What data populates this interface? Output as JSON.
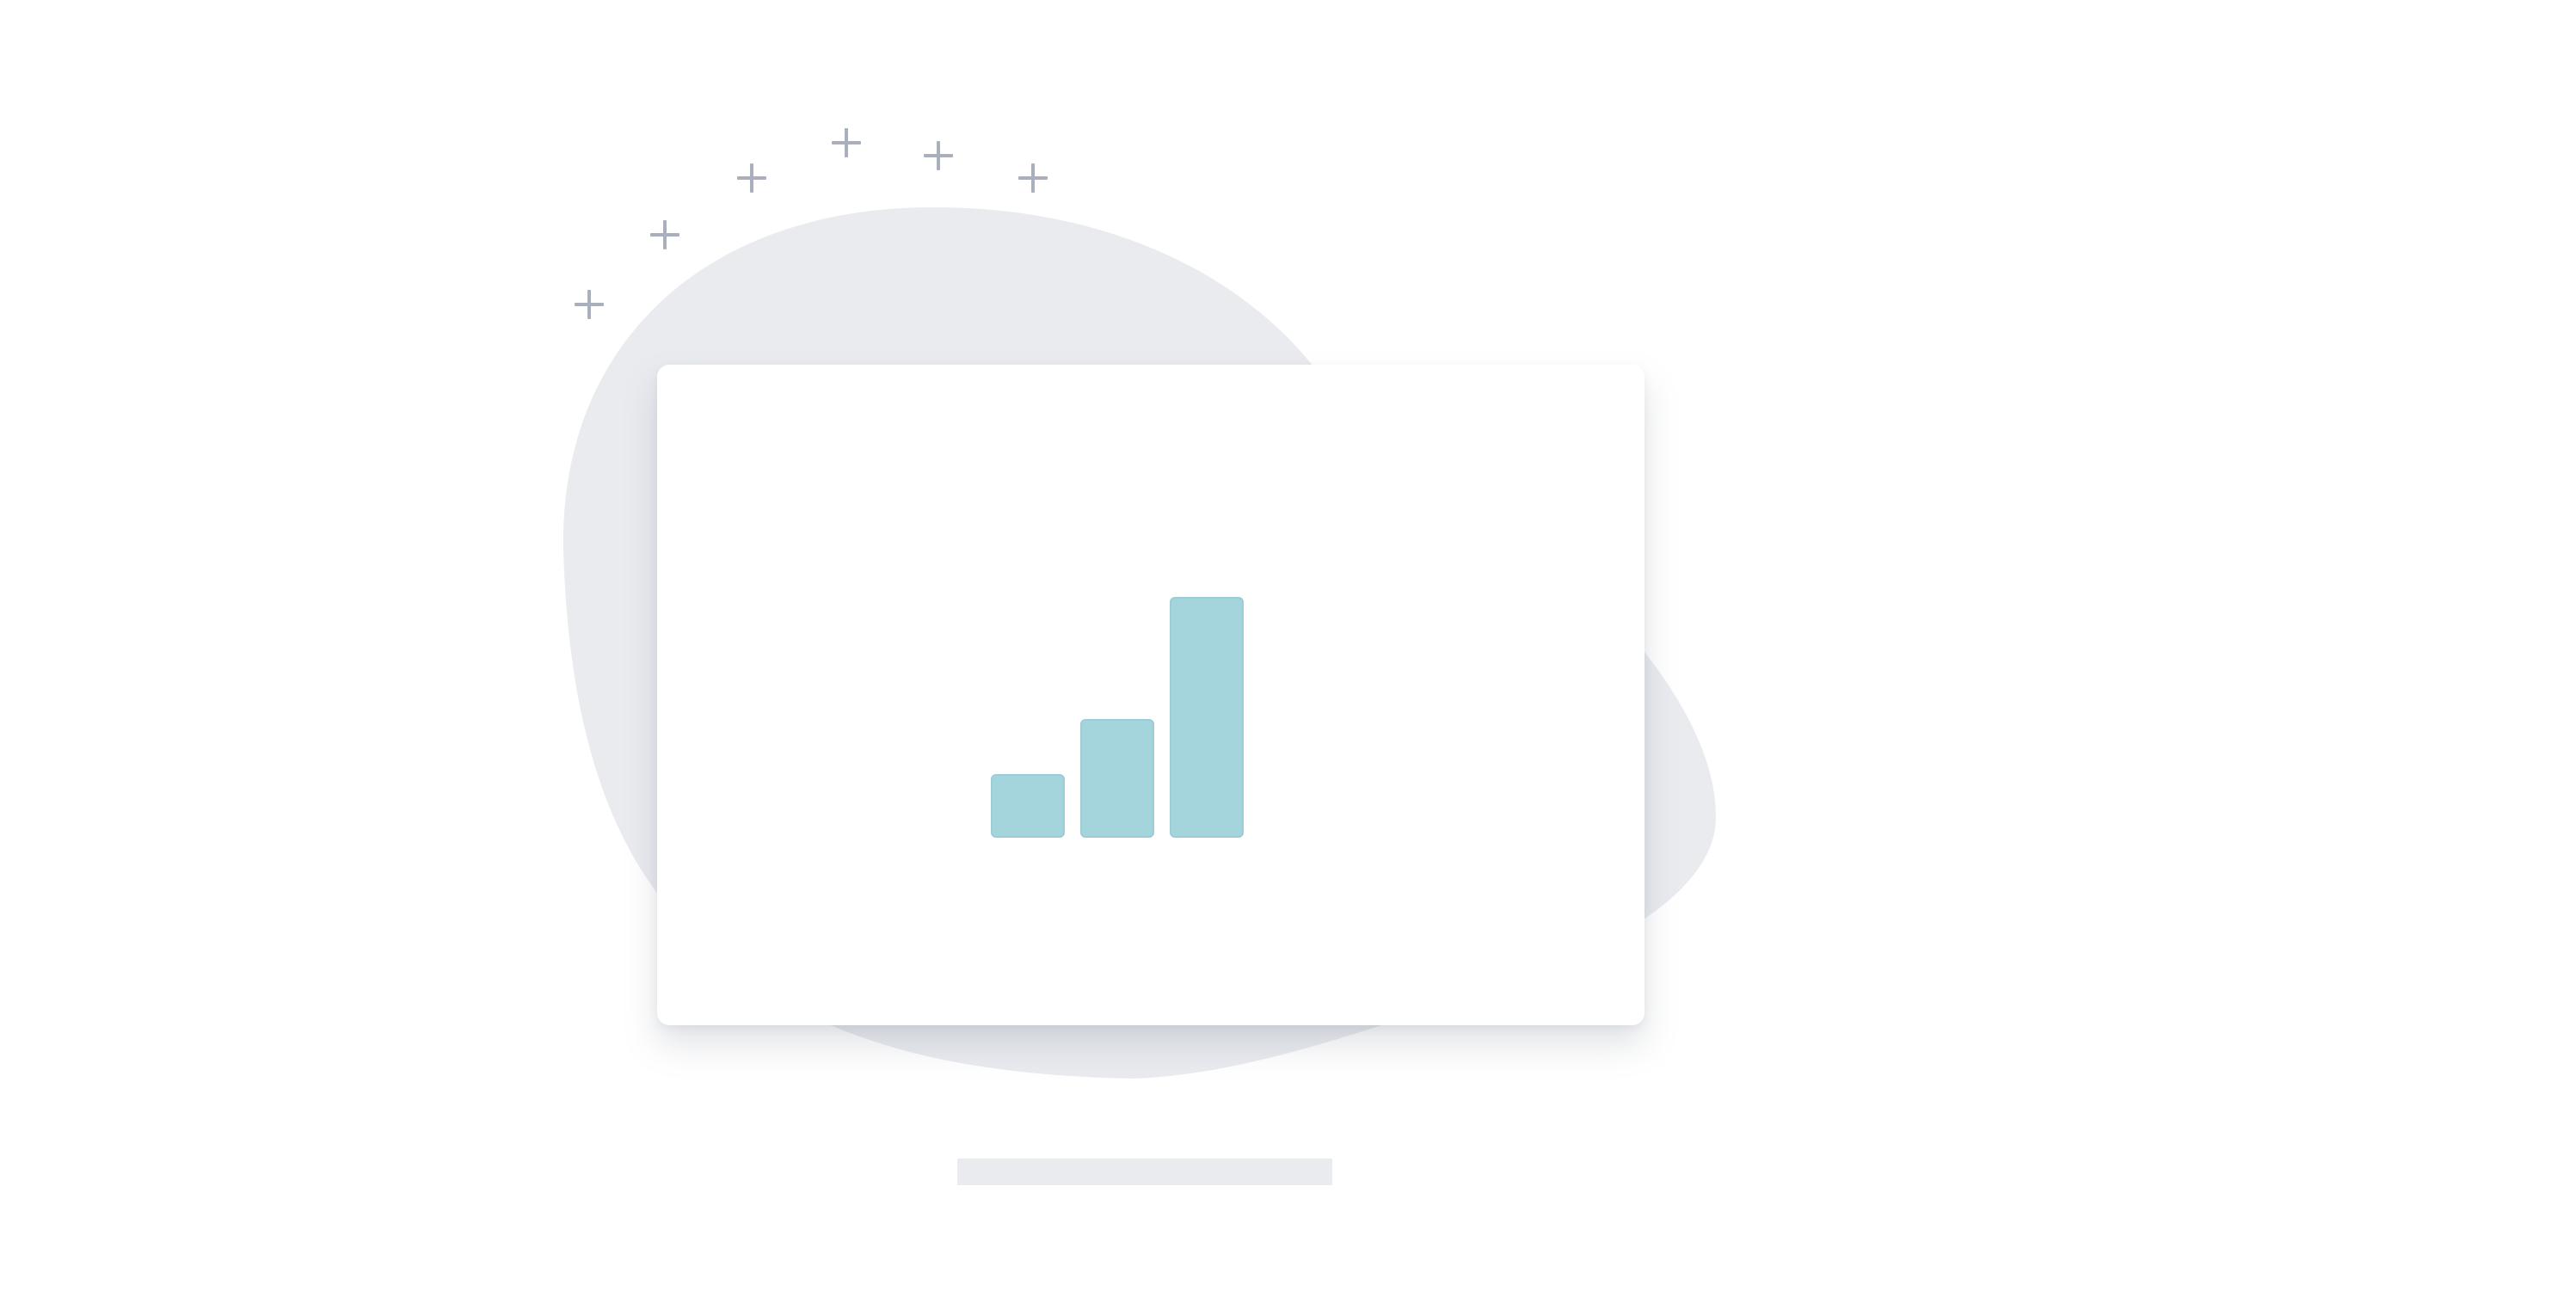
{
  "illustration": {
    "icon": "bar-chart-icon",
    "colors": {
      "background": "#ffffff",
      "blob": "#e9ebef",
      "card": "#ffffff",
      "accent": "#a4d4dc",
      "sparkle": "#a9b0bb",
      "stand": "#e9ebef"
    },
    "sparkles": [
      "plus-icon",
      "plus-icon",
      "plus-icon",
      "plus-icon",
      "plus-icon",
      "plus-icon"
    ]
  }
}
